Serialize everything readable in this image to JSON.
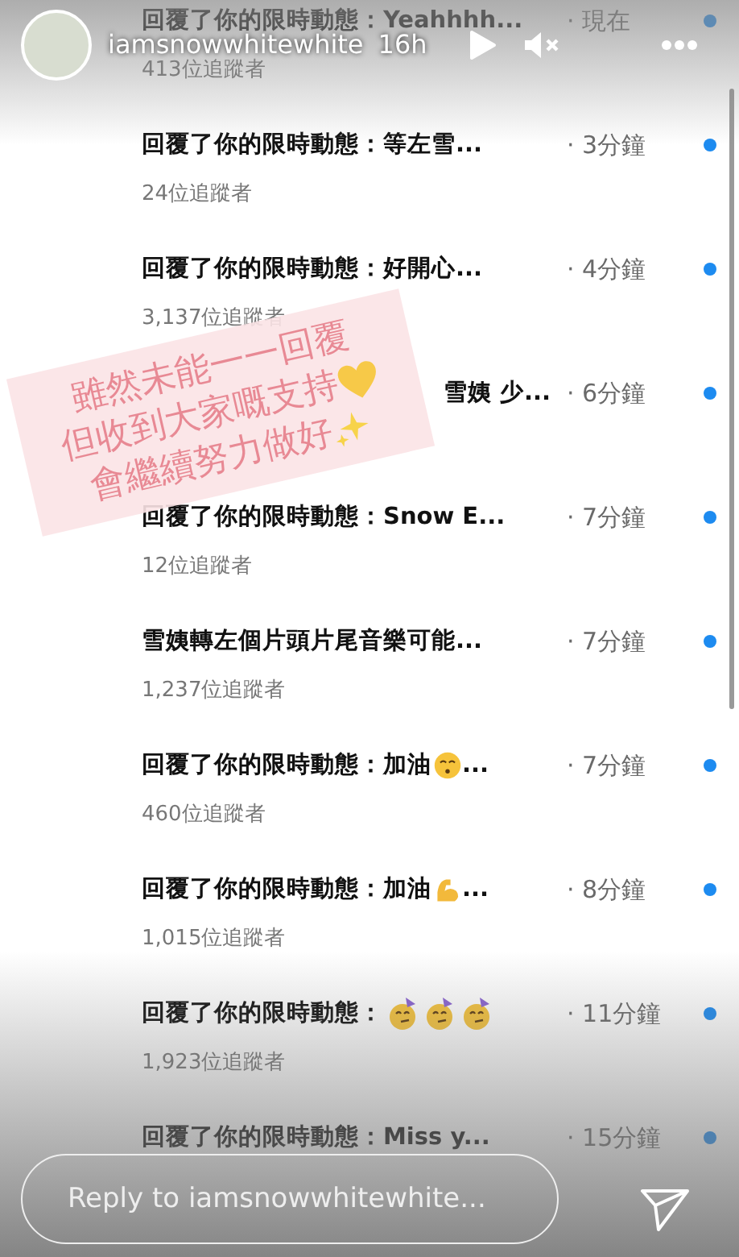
{
  "header": {
    "username": "iamsnowwhitewhite",
    "age": "16h"
  },
  "messages": [
    {
      "text": "回覆了你的限時動態：Yeahhhh...",
      "time": "· 現在",
      "followers": "413位追蹤者",
      "unread": true
    },
    {
      "text": "回覆了你的限時動態：等左雪...",
      "time": "· 3分鐘",
      "followers": "24位追蹤者",
      "unread": true
    },
    {
      "text": "回覆了你的限時動態：好開心...",
      "time": "· 4分鐘",
      "followers": "3,137位追蹤者",
      "unread": true
    },
    {
      "text": "雪姨 少...",
      "covered": true,
      "time": "· 6分鐘",
      "unread": true
    },
    {
      "text": "回覆了你的限時動態：Snow E...",
      "time": "· 7分鐘",
      "followers": "12位追蹤者",
      "unread": true
    },
    {
      "text": "雪姨轉左個片頭片尾音樂可能...",
      "time": "· 7分鐘",
      "followers": "1,237位追蹤者",
      "unread": true
    },
    {
      "text": "回覆了你的限時動態：加油",
      "emojis": [
        {
          "kind": "kiss"
        }
      ],
      "tail": "...",
      "time": "· 7分鐘",
      "followers": "460位追蹤者",
      "unread": true
    },
    {
      "text": "回覆了你的限時動態：加油",
      "emojis": [
        {
          "kind": "muscle"
        }
      ],
      "tail": "...",
      "time": "· 8分鐘",
      "followers": "1,015位追蹤者",
      "unread": true
    },
    {
      "text": "回覆了你的限時動態：",
      "emojis": [
        {
          "kind": "party"
        },
        {
          "kind": "party"
        },
        {
          "kind": "party"
        }
      ],
      "time": "· 11分鐘",
      "followers": "1,923位追蹤者",
      "unread": true
    },
    {
      "text": "回覆了你的限時動態：Miss y...",
      "time": "· 15分鐘",
      "unread": true
    }
  ],
  "sticker": {
    "lines": [
      {
        "text": "雖然未能一一回覆"
      },
      {
        "text": "但收到大家嘅支持",
        "kind": "heart"
      },
      {
        "text": "會繼續努力做好",
        "kind": "sparkles"
      }
    ]
  },
  "reply": {
    "placeholder": "Reply to iamsnowwhitewhite..."
  }
}
